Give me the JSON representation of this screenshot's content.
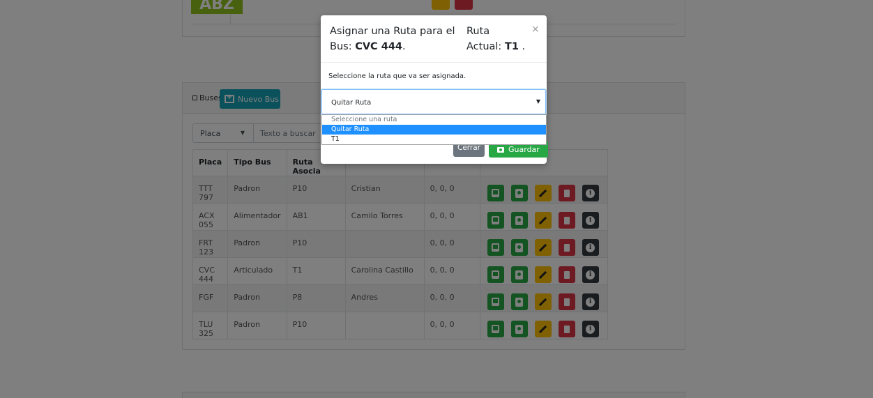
{
  "top_card": {
    "route_logo_text": "ABZ"
  },
  "buses_card": {
    "section_label": "Buses",
    "new_bus_button": "Nuevo Bus",
    "filter": {
      "field_selected": "Placa",
      "search_placeholder": "Texto a buscar"
    },
    "table": {
      "headers": [
        "Placa",
        "Tipo Bus",
        "Ruta Asocia",
        "",
        "",
        ""
      ],
      "rows": [
        {
          "placa": "TTT 797",
          "tipo": "Padron",
          "ruta": "P10",
          "conductor": "Cristian",
          "coords": "0, 0, 0"
        },
        {
          "placa": "ACX 055",
          "tipo": "Alimentador",
          "ruta": "AB1",
          "conductor": "Camilo Torres",
          "coords": "0, 0, 0"
        },
        {
          "placa": "FRT 123",
          "tipo": "Padron",
          "ruta": "P10",
          "conductor": "",
          "coords": "0, 0, 0"
        },
        {
          "placa": "CVC 444",
          "tipo": "Articulado",
          "ruta": "T1",
          "conductor": "Carolina Castillo",
          "coords": "0, 0, 0"
        },
        {
          "placa": "FGF",
          "tipo": "Padron",
          "ruta": "P8",
          "conductor": "Andres",
          "coords": "0, 0, 0"
        },
        {
          "placa": "TLU 325",
          "tipo": "Padron",
          "ruta": "P10",
          "conductor": "",
          "coords": "0, 0, 0"
        }
      ]
    },
    "row_actions": [
      "bus-icon",
      "id-badge-icon",
      "pencil-icon",
      "trash-icon",
      "info-icon"
    ]
  },
  "modal": {
    "title_prefix": "Asignar una Ruta para el Bus: ",
    "title_bus": "CVC 444",
    "title_suffix": ".",
    "current_prefix": "Ruta Actual: ",
    "current_route": "T1",
    "current_suffix": " .",
    "close_symbol": "×",
    "hint": "Seleccione la ruta que va ser asignada.",
    "select_value": "Quitar Ruta",
    "options": [
      "Seleccione una ruta",
      "Quitar Ruta",
      "T1"
    ],
    "cancel_label": "Cerrar",
    "save_label": "Guardar"
  },
  "colors": {
    "primary_info": "#17a2b8",
    "success": "#28a745",
    "warning": "#ffc107",
    "danger": "#dc3545",
    "dark": "#343a40",
    "selected_option": "#1e90ff"
  }
}
